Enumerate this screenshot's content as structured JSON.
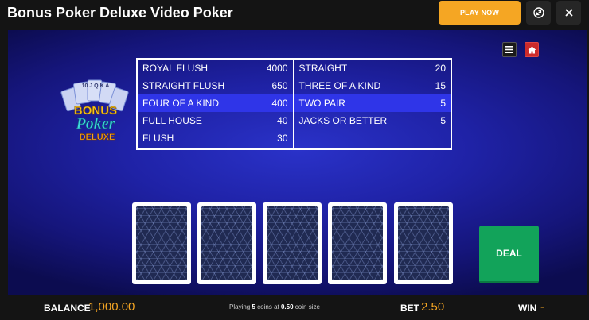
{
  "header": {
    "title": "Bonus Poker Deluxe Video Poker",
    "play_now": "PLAY NOW"
  },
  "logo": {
    "line1": "BONUS",
    "line2": "Poker",
    "line3": "DELUXE",
    "card_ranks": "10 J Q K A"
  },
  "paytable": {
    "left": [
      {
        "hand": "ROYAL FLUSH",
        "pay": "4000"
      },
      {
        "hand": "STRAIGHT FLUSH",
        "pay": "650"
      },
      {
        "hand": "FOUR OF A KIND",
        "pay": "400"
      },
      {
        "hand": "FULL HOUSE",
        "pay": "40"
      },
      {
        "hand": "FLUSH",
        "pay": "30"
      }
    ],
    "right": [
      {
        "hand": "STRAIGHT",
        "pay": "20"
      },
      {
        "hand": "THREE OF A KIND",
        "pay": "15"
      },
      {
        "hand": "TWO PAIR",
        "pay": "5"
      },
      {
        "hand": "JACKS OR BETTER",
        "pay": "5"
      }
    ]
  },
  "cards": [
    "card-back",
    "card-back",
    "card-back",
    "card-back",
    "card-back"
  ],
  "deal_label": "DEAL",
  "footer": {
    "balance_label": "BALANCE",
    "balance_value": "1,000.00",
    "info_prefix": "Playing",
    "info_coins": "5",
    "info_mid": "coins at",
    "info_size": "0.50",
    "info_suffix": "coin size",
    "bet_label": "BET",
    "bet_value": "2.50",
    "win_label": "WIN",
    "win_value": "-"
  },
  "colors": {
    "accent": "#f5a623",
    "deal_green": "#12a35a",
    "home_red": "#cc2b2b",
    "table_highlight": "#2f35e8"
  }
}
